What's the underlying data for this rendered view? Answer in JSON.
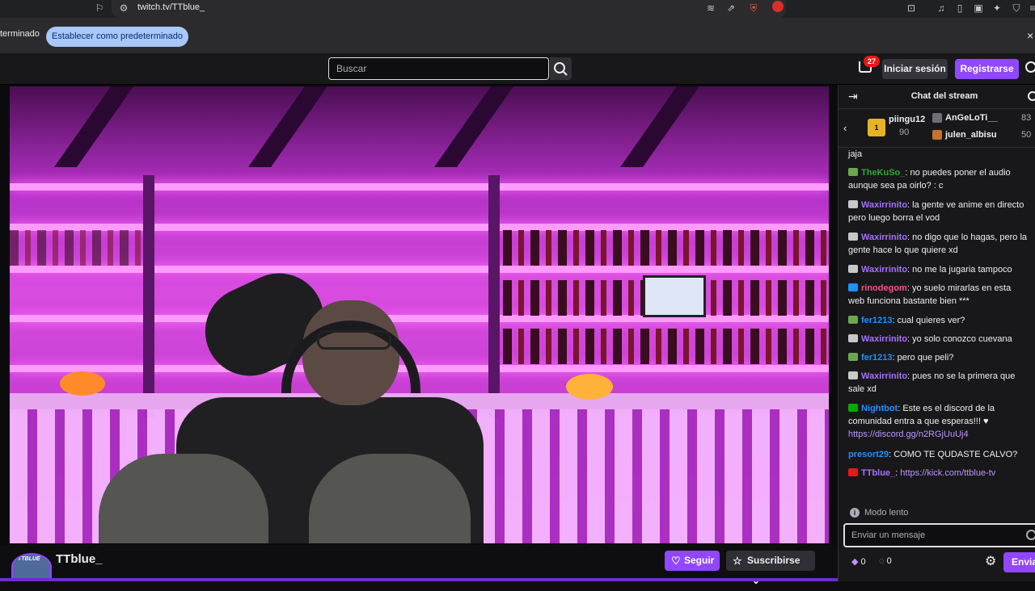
{
  "browser": {
    "url": "twitch.tv/TTblue_",
    "icons": [
      "bookmark-icon",
      "site-settings-icon",
      "reader-icon",
      "share-icon",
      "brave-shield-icon",
      "rewards-icon",
      "screenshot-icon",
      "media-icon",
      "sidebar-icon",
      "wallet-icon",
      "leo-icon",
      "vpn-icon",
      "menu-icon"
    ]
  },
  "infobar": {
    "text": "terminado",
    "button": "Establecer como predeterminado",
    "close": "×"
  },
  "nav": {
    "search_placeholder": "Buscar",
    "notif_count": "27",
    "login": "Iniciar sesión",
    "signup": "Registrarse"
  },
  "player": {
    "channel": "TTblue_",
    "avatar_text": "TTBLUE",
    "follow": "Seguir",
    "subscribe": "Suscribirse"
  },
  "chat": {
    "title": "Chat del stream",
    "leaderboard": [
      {
        "name": "piingu12",
        "value": "90"
      },
      {
        "name": "AnGeLoTi__",
        "value": "83"
      },
      {
        "name": "julen_albisu",
        "value": "50"
      }
    ],
    "gift_count": "1",
    "messages": [
      {
        "user": "",
        "text": "jaja",
        "color": "#efeff1",
        "badge": ""
      },
      {
        "user": "TheKuSo_",
        "text": ": no puedes poner el audio aunque sea pa oirlo? : c",
        "color": "#2eaa2e",
        "badge": "#6aa84f"
      },
      {
        "user": "Waxirrinito",
        "text": ": la gente ve anime en directo pero luego borra el vod",
        "color": "#a970ff",
        "badge": "#c8c8c8"
      },
      {
        "user": "Waxirrinito",
        "text": ": no digo que lo hagas, pero la gente hace lo que quiere xd",
        "color": "#a970ff",
        "badge": "#c8c8c8"
      },
      {
        "user": "Waxirrinito",
        "text": ": no me la jugaria tampoco",
        "color": "#a970ff",
        "badge": "#c8c8c8"
      },
      {
        "user": "rinodegom",
        "text": ": yo suelo mirarlas en esta web funciona bastante bien ***",
        "color": "#ff4f8b",
        "badge": "#1e90ff"
      },
      {
        "user": "fer1213",
        "text": ": cual quieres ver?",
        "color": "#1e90ff",
        "badge": "#6aa84f"
      },
      {
        "user": "Waxirrinito",
        "text": ": yo solo conozco cuevana",
        "color": "#a970ff",
        "badge": "#c8c8c8"
      },
      {
        "user": "fer1213",
        "text": ": pero que peli?",
        "color": "#1e90ff",
        "badge": "#6aa84f"
      },
      {
        "user": "Waxirrinito",
        "text": ": pues no se la primera que sale xd",
        "color": "#a970ff",
        "badge": "#c8c8c8"
      },
      {
        "user": "Nightbot",
        "text": ": Este es el discord de la comunidad entra a que esperas!!! ♥ ",
        "link": "https://discord.gg/n2RGjUuUj4",
        "color": "#1e90ff",
        "badge": "#00ad03"
      },
      {
        "user": "presort29",
        "text": ": COMO TE QUDASTE CALVO?",
        "color": "#1e90ff",
        "badge": ""
      },
      {
        "user": "TTblue_",
        "text": ": ",
        "link": "https://kick.com/ttblue-tv",
        "color": "#a970ff",
        "badge": "#e91916"
      }
    ],
    "slow_mode": "Modo lento",
    "input_placeholder": "Enviar un mensaje",
    "bits": "0",
    "points": "0",
    "send": "Enviar"
  }
}
